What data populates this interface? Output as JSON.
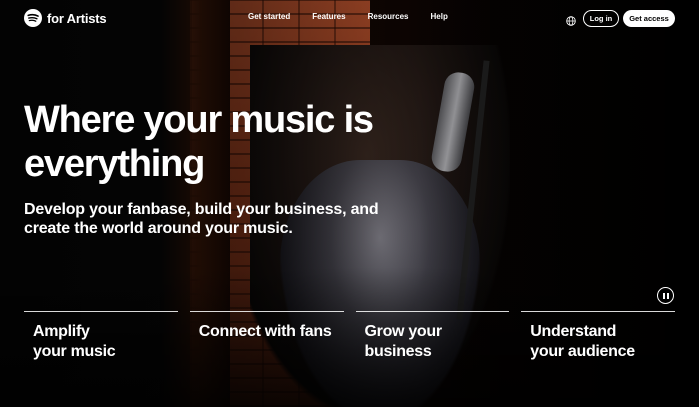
{
  "nav": {
    "logo_text": "for Artists",
    "links": [
      "Get started",
      "Features",
      "Resources",
      "Help"
    ],
    "login_label": "Log in",
    "access_label": "Get access"
  },
  "hero": {
    "headline": "Where your music is everything",
    "subhead": "Develop your fanbase, build your business, and create the world around your music."
  },
  "cards": [
    {
      "title": "Amplify\nyour music"
    },
    {
      "title": "Connect with fans"
    },
    {
      "title": "Grow your\nbusiness"
    },
    {
      "title": "Understand\nyour audience"
    }
  ],
  "colors": {
    "background": "#000000",
    "text": "#ffffff",
    "brick": "#b5502c"
  },
  "icons": [
    "spotify-logo-icon",
    "globe-icon",
    "pause-icon"
  ]
}
